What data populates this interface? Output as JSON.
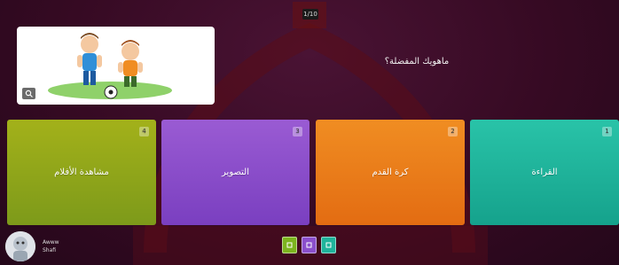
{
  "header": {
    "question_counter": "1/10"
  },
  "question": {
    "text": "ماهويك المفضلة؟",
    "image": "cartoon-kids-playing-soccer"
  },
  "answers": [
    {
      "label": "مشاهدة الأفلام",
      "badge": "4",
      "color": "#8fa41a"
    },
    {
      "label": "التصوير",
      "badge": "3",
      "color": "#8b4fcc"
    },
    {
      "label": "كرة القدم",
      "badge": "2",
      "color": "#ea7d1b"
    },
    {
      "label": "القراءة",
      "badge": "1",
      "color": "#1fb39b"
    }
  ],
  "player": {
    "line1": "Awww",
    "line2": "Shafi"
  },
  "nav": [
    {
      "color": "#7cb51e"
    },
    {
      "color": "#8b4fcc"
    },
    {
      "color": "#1fb39b"
    }
  ]
}
